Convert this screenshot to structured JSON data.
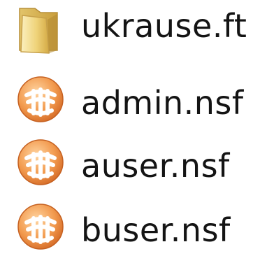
{
  "files": [
    {
      "name": "ukrause.ft",
      "icon": "folder-icon"
    },
    {
      "name": "admin.nsf",
      "icon": "lotus-notes-database-icon"
    },
    {
      "name": "auser.nsf",
      "icon": "lotus-notes-database-icon"
    },
    {
      "name": "buser.nsf",
      "icon": "lotus-notes-database-icon"
    }
  ],
  "colors": {
    "folder_light": "#f6e7a6",
    "folder_dark": "#d9b85a",
    "lotus_outer": "#f0a05a",
    "lotus_inner": "#ffffff",
    "text": "#141414"
  }
}
